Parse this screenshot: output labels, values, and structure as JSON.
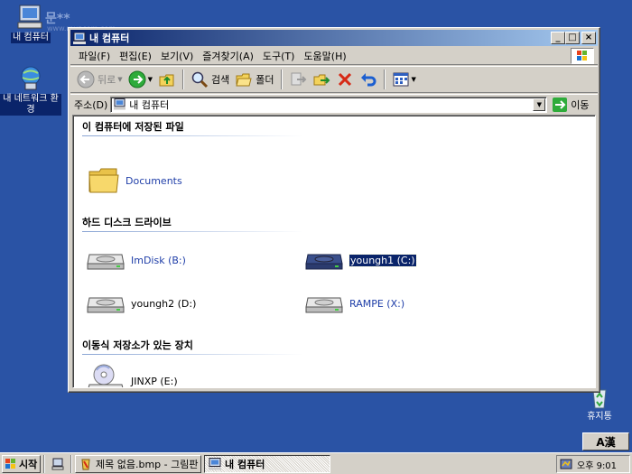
{
  "desktop": {
    "watermark": "문**",
    "watermark_sub": "www.muncom.com",
    "icons": [
      {
        "label": "내 컴퓨터"
      },
      {
        "label": "내 네트워크 환경"
      },
      {
        "label": "휴지통"
      }
    ]
  },
  "window": {
    "title": "내 컴퓨터",
    "controls": {
      "minimize": "_",
      "maximize": "□",
      "close": "×"
    },
    "menu": [
      "파일(F)",
      "편집(E)",
      "보기(V)",
      "즐겨찾기(A)",
      "도구(T)",
      "도움말(H)"
    ],
    "toolbar": {
      "back": "뒤로",
      "search": "검색",
      "folders": "폴더"
    },
    "address": {
      "label": "주소(D)",
      "value": "내 컴퓨터",
      "go": "이동"
    },
    "groups": [
      {
        "title": "이 컴퓨터에 저장된 파일",
        "items": [
          {
            "name": "Documents"
          }
        ]
      },
      {
        "title": "하드 디스크 드라이브",
        "items": [
          {
            "name": "ImDisk (B:)"
          },
          {
            "name": "youngh1 (C:)"
          },
          {
            "name": "youngh2 (D:)"
          },
          {
            "name": "RAMPE (X:)"
          }
        ]
      },
      {
        "title": "이동식 저장소가 있는 장치",
        "items": [
          {
            "name": "JINXP (E:)"
          }
        ]
      }
    ]
  },
  "taskbar": {
    "start": "시작",
    "tasks": [
      {
        "label": "제목 없음.bmp - 그림판"
      },
      {
        "label": "내 컴퓨터"
      }
    ],
    "clock": "오후 9:01",
    "ime": "A漢"
  },
  "colors": {
    "desktop": "#2a53a5",
    "titlebar_start": "#0a246a",
    "titlebar_end": "#a6caf0",
    "link": "#1f3ea8"
  }
}
